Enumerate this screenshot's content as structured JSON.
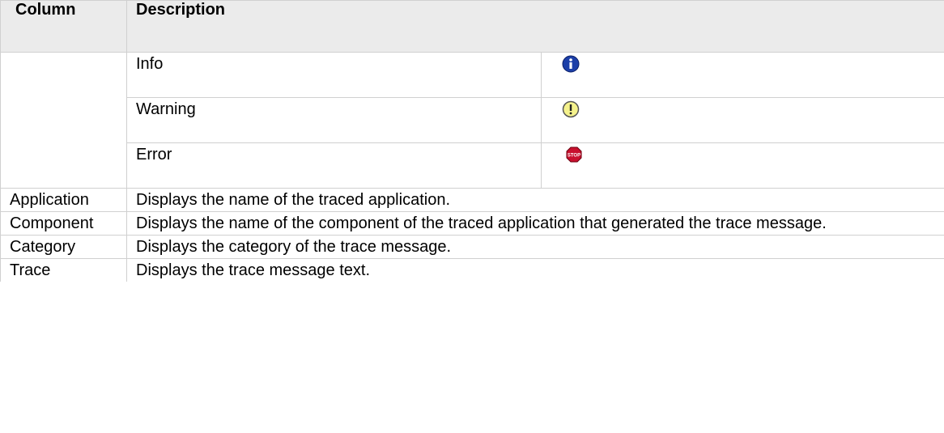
{
  "table": {
    "headers": [
      "Column",
      "Description"
    ],
    "severity_levels": [
      {
        "label": "Info",
        "icon": "info-icon",
        "color": "#1c3fa8"
      },
      {
        "label": "Warning",
        "icon": "warning-icon",
        "color": "#f2f08a"
      },
      {
        "label": "Error",
        "icon": "stop-icon",
        "color": "#c8102e"
      }
    ],
    "rows": [
      {
        "column": "Application",
        "description": "Displays the name of the traced application."
      },
      {
        "column": "Component",
        "description": "Displays the name of the component of the traced application that generated the trace message."
      },
      {
        "column": "Category",
        "description": "Displays the category of the trace message."
      },
      {
        "column": "Trace",
        "description": "Displays the trace message text."
      }
    ],
    "stop_icon_text": "STOP"
  }
}
